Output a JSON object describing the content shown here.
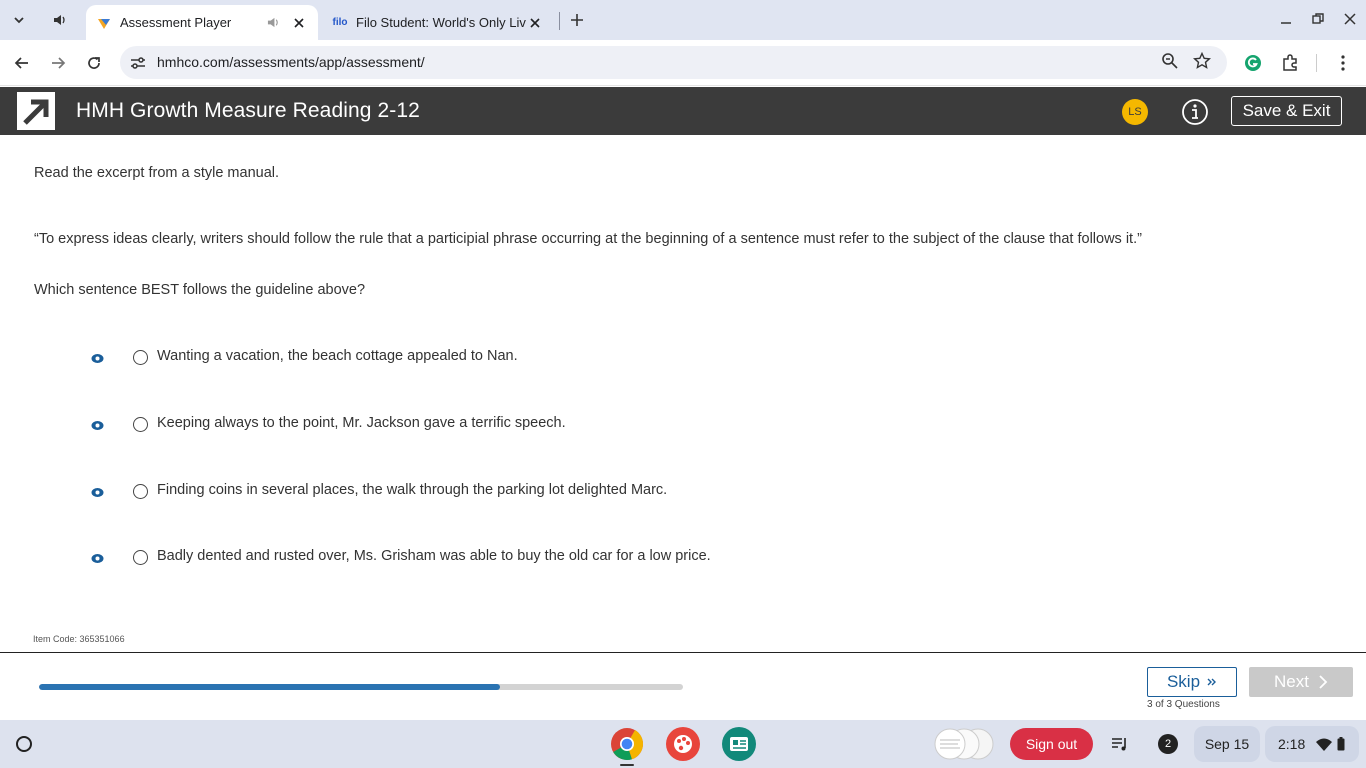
{
  "browser": {
    "tabs": [
      {
        "title": "Assessment Player",
        "active": true
      },
      {
        "title": "Filo Student: World's Only Live",
        "favicon_text": "filo",
        "active": false
      }
    ],
    "url": "hmhco.com/assessments/app/assessment/"
  },
  "app": {
    "title": "HMH Growth Measure Reading 2-12",
    "avatar_initials": "LS",
    "save_exit_label": "Save & Exit"
  },
  "question": {
    "intro": "Read the excerpt from a style manual.",
    "excerpt": "“To express ideas clearly, writers should follow the rule that a participial phrase occurring at the beginning of a sentence must refer to the subject of the clause that follows it.”",
    "prompt": "Which sentence BEST follows the guideline above?",
    "options": [
      {
        "text": "Wanting a vacation, the beach cottage appealed to Nan."
      },
      {
        "text": "Keeping always to the point, Mr. Jackson gave a terrific speech."
      },
      {
        "text": "Finding coins in several places, the walk through the parking lot delighted Marc."
      },
      {
        "text": "Badly dented and rusted over, Ms. Grisham was able to buy the old car for a low price."
      }
    ],
    "item_code": "Item Code: 365351066"
  },
  "footer": {
    "progress_fraction": 0.716,
    "skip_label": "Skip",
    "next_label": "Next",
    "question_count": "3 of 3 Questions"
  },
  "shelf": {
    "sign_out_label": "Sign out",
    "notification_count": "2",
    "date": "Sep 15",
    "time": "2:18"
  },
  "colors": {
    "header_bg": "#3b3b3b",
    "accent_blue": "#1a5e9a",
    "progress": "#2a73b2",
    "avatar": "#f5b800",
    "sign_out": "#d93045"
  }
}
